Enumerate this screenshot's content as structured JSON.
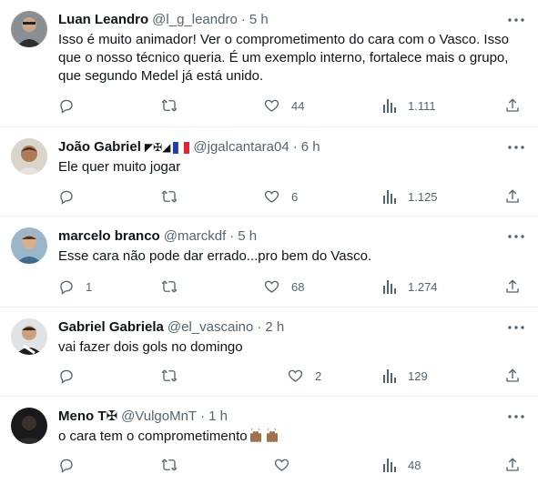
{
  "tweets": [
    {
      "name": "Luan Leandro",
      "handle": "@l_g_leandro",
      "time": "5 h",
      "text": "Isso é muito animador! Ver o comprometimento do cara com o Vasco. Isso\nque o nosso técnico queria. É um exemplo interno, fortalece mais o grupo,\nque segundo Medel já está unido.",
      "replies": "",
      "retweets": "",
      "likes": "44",
      "views": "1.111"
    },
    {
      "name": "João Gabriel",
      "handle": "@jgalcantara04",
      "time": "6 h",
      "text": "Ele quer muito jogar",
      "replies": "",
      "retweets": "",
      "likes": "6",
      "views": "1.125"
    },
    {
      "name": "marcelo branco",
      "handle": "@marckdf",
      "time": "5 h",
      "text": "Esse cara não pode dar errado...pro bem do Vasco.",
      "replies": "1",
      "retweets": "",
      "likes": "68",
      "views": "1.274"
    },
    {
      "name": "Gabriel Gabriela",
      "handle": "@el_vascaino",
      "time": "2 h",
      "text": "vai fazer dois gols no domingo",
      "replies": "",
      "retweets": "",
      "likes": "2",
      "views": "129"
    },
    {
      "name": "Meno T✠",
      "handle": "@VulgoMnT",
      "time": "1 h",
      "text": "o cara tem o comprometimento",
      "replies": "",
      "retweets": "",
      "likes": "",
      "views": "48"
    }
  ],
  "badges": {
    "joao": "◤✠◢"
  },
  "colors": {
    "text": "#0f1419",
    "secondary": "#536471",
    "divider": "#eff3f4"
  }
}
